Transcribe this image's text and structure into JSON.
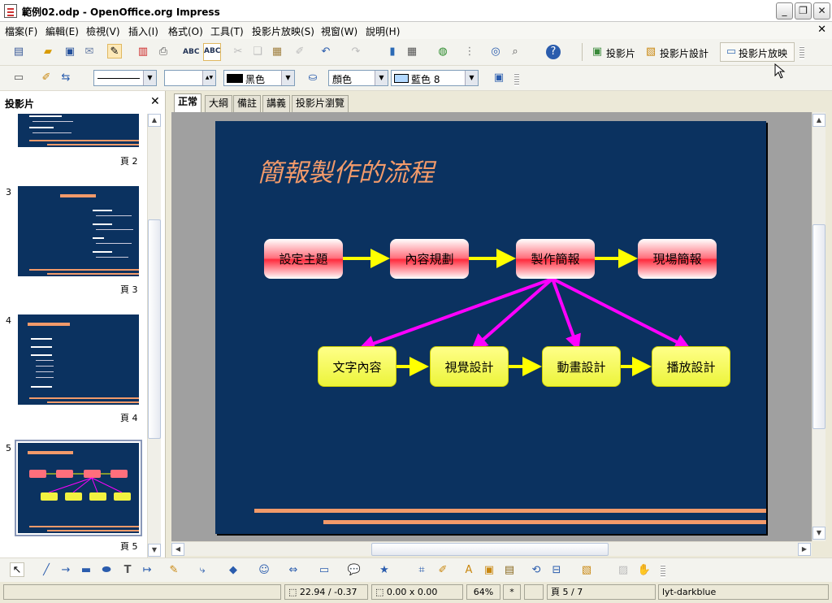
{
  "window": {
    "title": "範例02.odp - OpenOffice.org Impress"
  },
  "menu": [
    "檔案(F)",
    "編輯(E)",
    "檢視(V)",
    "插入(I)",
    "格式(O)",
    "工具(T)",
    "投影片放映(S)",
    "視窗(W)",
    "說明(H)"
  ],
  "toolbar": {
    "slide_label": "投影片",
    "slide_design_label": "投影片設計",
    "slideshow_label": "投影片放映"
  },
  "format_bar": {
    "line_color": "黑色",
    "area_style": "顏色",
    "area_color": "藍色 8",
    "line_width": ""
  },
  "panel": {
    "title": "投影片",
    "pages": [
      {
        "num": "",
        "label": "頁 2"
      },
      {
        "num": "3",
        "label": "頁 3"
      },
      {
        "num": "4",
        "label": "頁 4"
      },
      {
        "num": "5",
        "label": "頁 5"
      }
    ]
  },
  "tabs": [
    "正常",
    "大綱",
    "備註",
    "講義",
    "投影片瀏覽"
  ],
  "slide": {
    "title": "簡報製作的流程",
    "top_row": [
      "設定主題",
      "內容規劃",
      "製作簡報",
      "現場簡報"
    ],
    "bottom_row": [
      "文字內容",
      "視覺設計",
      "動畫設計",
      "播放設計"
    ]
  },
  "status": {
    "position": "22.94 / -0.37",
    "size": "0.00 x 0.00",
    "zoom": "64%",
    "modified": "*",
    "page": "頁 5 / 7",
    "layout": "lyt-darkblue"
  },
  "colors": {
    "slide_bg": "#0b3260",
    "title_color": "#f29a6a",
    "arrow_yellow": "#ffff00",
    "arrow_magenta": "#ff00ff"
  }
}
